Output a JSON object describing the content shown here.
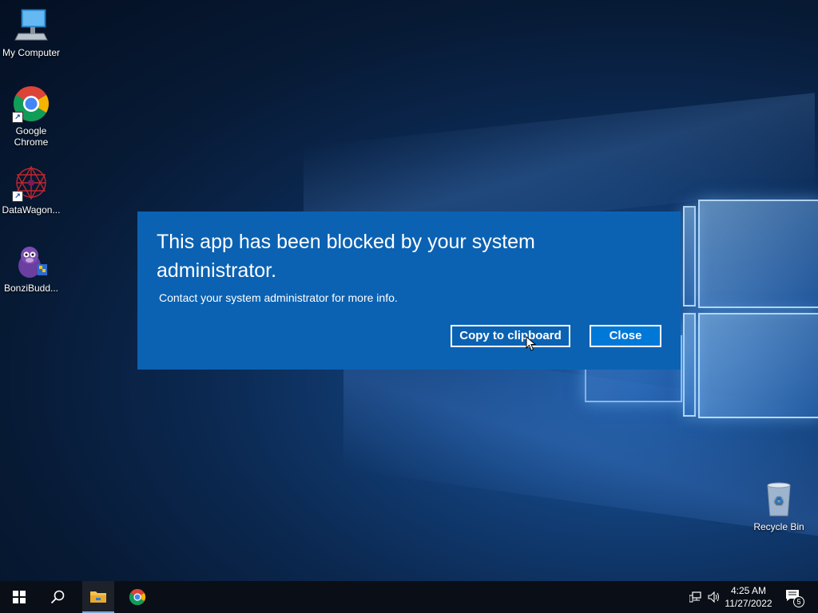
{
  "desktop": {
    "icons": [
      {
        "label": "My Computer",
        "icon": "computer-icon"
      },
      {
        "label": "Google Chrome",
        "icon": "chrome-icon"
      },
      {
        "label": "DataWagon...",
        "icon": "datawagon-icon"
      },
      {
        "label": "BonziBudd...",
        "icon": "bonzibuddy-icon"
      },
      {
        "label": "Recycle Bin",
        "icon": "recycle-bin-icon"
      }
    ]
  },
  "dialog": {
    "title": "This app has been blocked by your system administrator.",
    "message": "Contact your system administrator for more info.",
    "copy_label": "Copy to clipboard",
    "close_label": "Close",
    "bg_color": "#0b62b3"
  },
  "taskbar": {
    "time": "4:25 AM",
    "date": "11/27/2022",
    "notification_count": "5",
    "items": [
      "start-icon",
      "search-icon",
      "file-explorer-icon",
      "chrome-icon"
    ],
    "tray_icons": [
      "network-icon",
      "volume-icon",
      "action-center-icon"
    ]
  }
}
